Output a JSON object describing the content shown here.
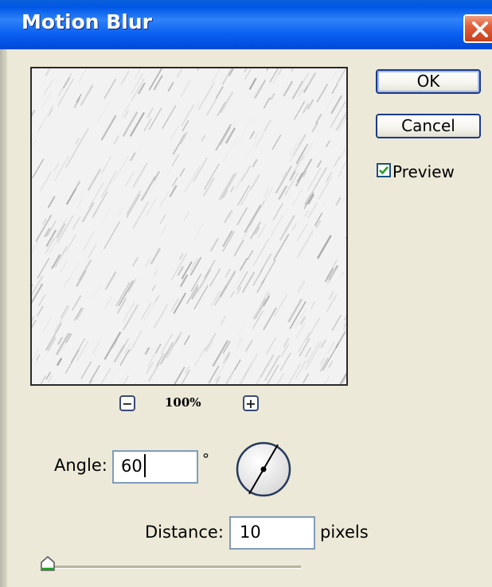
{
  "window": {
    "title": "Motion Blur",
    "close_icon": "close-icon"
  },
  "buttons": {
    "ok_label": "OK",
    "cancel_label": "Cancel"
  },
  "preview_checkbox": {
    "label": "Preview",
    "checked": true
  },
  "zoom": {
    "level": "100%",
    "zoom_out_glyph": "−",
    "zoom_in_glyph": "+"
  },
  "angle": {
    "label": "Angle:",
    "value": "60",
    "unit": "°",
    "dial_angle_degrees": 60
  },
  "distance": {
    "label": "Distance:",
    "value": "10",
    "unit": "pixels"
  },
  "colors": {
    "title_bar": "#0a5fd8",
    "dialog_bg": "#ece9d8",
    "close_button": "#e0603c",
    "check_mark": "#21a121",
    "input_border": "#7f9db9"
  }
}
